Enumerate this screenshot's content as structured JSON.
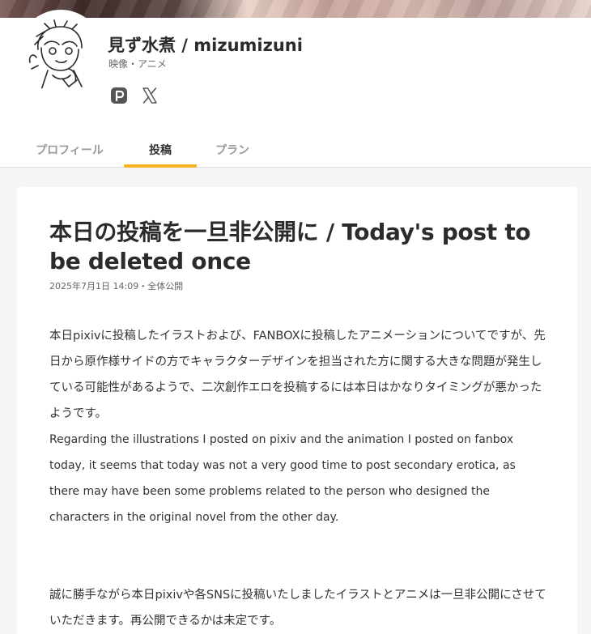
{
  "creator": {
    "name": "見ず水煮 / mizumizuni",
    "category": "映像・アニメ",
    "social": [
      {
        "icon": "pixiv-icon"
      },
      {
        "icon": "x-icon"
      }
    ]
  },
  "tabs": [
    {
      "label": "プロフィール",
      "active": false
    },
    {
      "label": "投稿",
      "active": true
    },
    {
      "label": "プラン",
      "active": false
    }
  ],
  "post": {
    "title": "本日の投稿を一旦非公開に / Today's post to be deleted once",
    "meta": "2025年7月1日 14:09・全体公開",
    "paragraphs": [
      "本日pixivに投稿したイラストおよび、FANBOXに投稿したアニメーションについてですが、先日から原作様サイドの方でキャラクターデザインを担当された方に関する大きな問題が発生している可能性があるようで、二次創作エロを投稿するには本日はかなりタイミングが悪かったようです。",
      "Regarding the illustrations I posted on pixiv and the animation I posted on fanbox today, it seems that today was not a very good time to post secondary erotica, as there may have been some problems related to the person who designed the characters in the original novel from the other day.",
      "誠に勝手ながら本日pixivや各SNSに投稿いたしましたイラストとアニメは一旦非公開にさせていただきます。再公開できるかは未定です。"
    ]
  },
  "colors": {
    "accent": "#f7b322",
    "background": "#f5f5f7",
    "card": "#ffffff",
    "text": "#333333"
  }
}
